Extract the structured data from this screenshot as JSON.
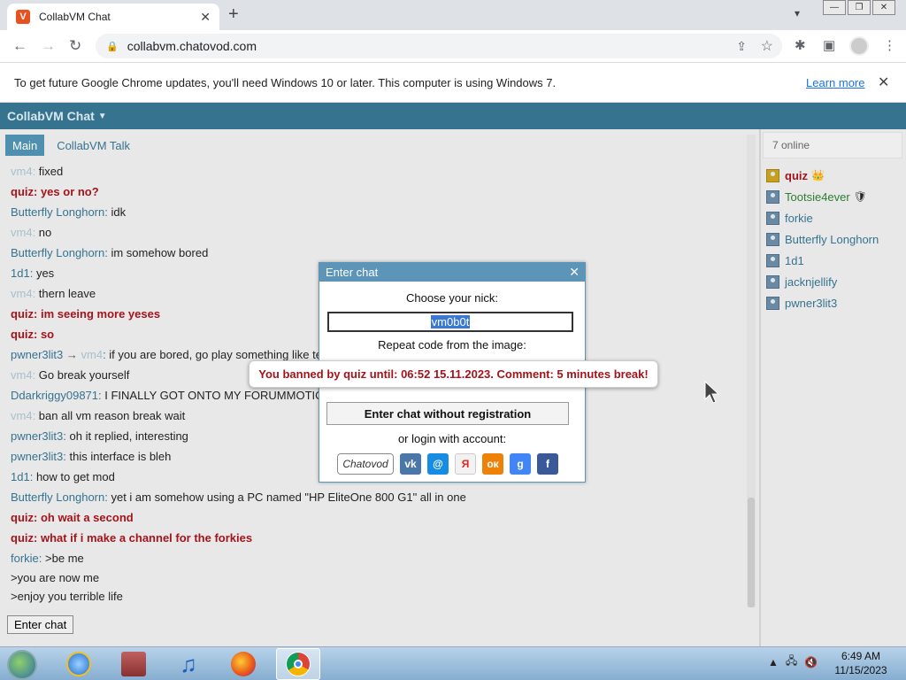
{
  "browser": {
    "tab_title": "CollabVM Chat",
    "tab_favicon": "V",
    "url": "collabvm.chatovod.com",
    "infobar_message": "To get future Google Chrome updates, you'll need Windows 10 or later. This computer is using Windows 7.",
    "infobar_link": "Learn more"
  },
  "app": {
    "title": "CollabVM Chat",
    "tabs": [
      {
        "label": "Main"
      },
      {
        "label": "CollabVM Talk"
      }
    ],
    "enter_chat_button": "Enter chat",
    "online_count": "7 online"
  },
  "messages": [
    {
      "nick": "vm4",
      "sep": ": ",
      "text": "fixed",
      "style": "faded"
    },
    {
      "nick": "quiz",
      "sep": ": ",
      "text": "yes or no?",
      "style": "red"
    },
    {
      "nick": "Butterfly Longhorn",
      "sep": ": ",
      "text": "idk",
      "style": "normal"
    },
    {
      "nick": "vm4",
      "sep": ": ",
      "text": "no",
      "style": "faded"
    },
    {
      "nick": "Butterfly Longhorn",
      "sep": ": ",
      "text": "im somehow bored",
      "style": "normal"
    },
    {
      "nick": "1d1",
      "sep": ": ",
      "text": "yes",
      "style": "normal"
    },
    {
      "nick": "vm4",
      "sep": ": ",
      "text": "thern leave",
      "style": "faded"
    },
    {
      "nick": "quiz",
      "sep": ": ",
      "text": "im seeing more yeses",
      "style": "red"
    },
    {
      "nick": "quiz",
      "sep": ": ",
      "text": "so",
      "style": "red"
    },
    {
      "nick": "pwner3lit3",
      "arrow": " → ",
      "to": "vm4",
      "sep": ": ",
      "text": "if you are bored, go play something like te",
      "style": "normal"
    },
    {
      "nick": "vm4",
      "sep": ": ",
      "text": "Go break yourself",
      "style": "faded"
    },
    {
      "nick": "Ddarkriggy09871",
      "sep": ": ",
      "text": "I FINALLY GOT ONTO MY FORUMMOTIO",
      "style": "normal"
    },
    {
      "nick": "vm4",
      "sep": ": ",
      "text": "ban all vm reason break wait",
      "style": "faded"
    },
    {
      "nick": "pwner3lit3",
      "sep": ": ",
      "text": "oh it replied, interesting",
      "style": "normal"
    },
    {
      "nick": "pwner3lit3",
      "sep": ": ",
      "text": "this interface is bleh",
      "style": "normal"
    },
    {
      "nick": "1d1",
      "sep": ": ",
      "text": "how to get mod",
      "style": "normal"
    },
    {
      "nick": "Butterfly Longhorn",
      "sep": ": ",
      "text": "yet i am somehow using a PC named \"HP EliteOne 800 G1\" all in one",
      "style": "normal"
    },
    {
      "nick": "quiz",
      "sep": ": ",
      "text": "oh wait a second",
      "style": "red"
    },
    {
      "nick": "quiz",
      "sep": ": ",
      "text": "what if i make a channel for the forkies",
      "style": "red"
    },
    {
      "nick": "forkie",
      "sep": ": ",
      "text": ">be me",
      "style": "normal"
    }
  ],
  "message_continuations": [
    ">you are now me",
    ">enjoy you terrible life"
  ],
  "users": [
    {
      "name": "quiz",
      "style": "red",
      "badge": "👑",
      "mod": true
    },
    {
      "name": "Tootsie4ever",
      "style": "green",
      "badge": "🛡",
      "mod": false
    },
    {
      "name": "forkie",
      "style": "normal",
      "badge": "",
      "mod": false
    },
    {
      "name": "Butterfly Longhorn",
      "style": "normal",
      "badge": "",
      "mod": false
    },
    {
      "name": "1d1",
      "style": "normal",
      "badge": "",
      "mod": false
    },
    {
      "name": "jacknjellify",
      "style": "normal",
      "badge": "",
      "mod": false
    },
    {
      "name": "pwner3lit3",
      "style": "normal",
      "badge": "",
      "mod": false
    }
  ],
  "dialog": {
    "title": "Enter chat",
    "choose_nick": "Choose your nick:",
    "nick_value": "vm0b0t",
    "repeat_code": "Repeat code from the image:",
    "enter_without_reg": "Enter chat without registration",
    "login_with": "or login with account:",
    "socials": [
      {
        "name": "chatovod",
        "label": "Chatovod",
        "color": "#ffffff"
      },
      {
        "name": "vk",
        "label": "vk",
        "color": "#4a76a8"
      },
      {
        "name": "mailru",
        "label": "@",
        "color": "#168de2"
      },
      {
        "name": "yandex",
        "label": "Я",
        "color": "#f2f2f2"
      },
      {
        "name": "odnoklassniki",
        "label": "ок",
        "color": "#ee8208"
      },
      {
        "name": "google",
        "label": "g",
        "color": "#4285f4"
      },
      {
        "name": "facebook",
        "label": "f",
        "color": "#3b5998"
      }
    ]
  },
  "ban_notice": "You banned by quiz until: 06:52 15.11.2023. Comment: 5 minutes break!",
  "taskbar": {
    "time": "6:49 AM",
    "date": "11/15/2023"
  },
  "colors": {
    "header": "#35738f",
    "accent_red": "#a3141b",
    "dialog_header": "#5c95b8"
  }
}
